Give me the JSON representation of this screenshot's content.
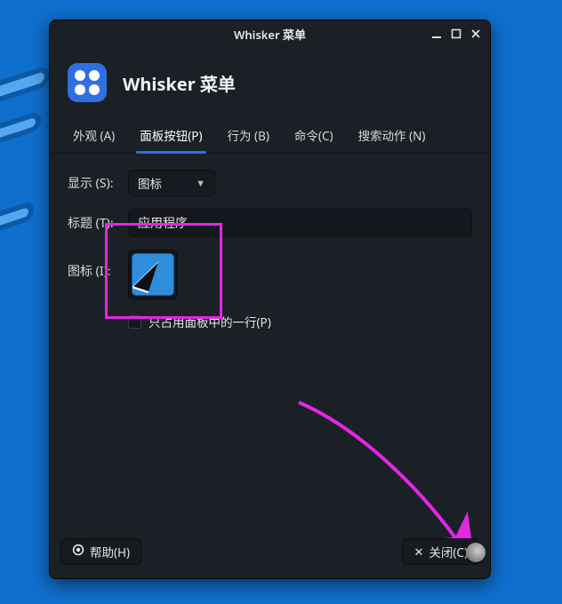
{
  "window": {
    "title": "Whisker 菜单"
  },
  "header": {
    "title": "Whisker 菜单"
  },
  "tabs": {
    "appearance": "外观 (A)",
    "panel_button": "面板按钮(P)",
    "behavior": "行为 (B)",
    "commands": "命令(C)",
    "search_actions": "搜索动作 (N)",
    "active": "panel_button"
  },
  "panel_button": {
    "display_label": "显示 (S):",
    "display_value": "图标",
    "title_label": "标题 (T):",
    "title_value": "应用程序",
    "icon_label": "图标 (I):",
    "single_row_label": "只占用面板中的一行(P)",
    "single_row_checked": false
  },
  "footer": {
    "help": "帮助(H)",
    "close": "关闭(C)"
  }
}
